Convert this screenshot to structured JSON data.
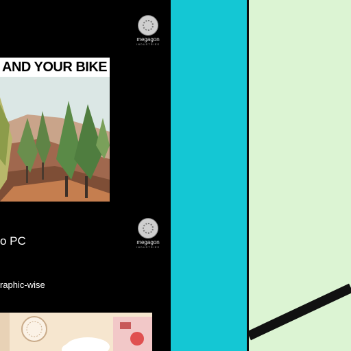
{
  "feed": {
    "card1": {
      "logo": {
        "brand": "megagon",
        "sub": "INDUSTRIES",
        "icon": "megagon-logo-icon"
      },
      "thumbnail_headline": "AND YOUR BIKE"
    },
    "card2": {
      "logo": {
        "brand": "megagon",
        "sub": "INDUSTRIES",
        "icon": "megagon-logo-icon"
      },
      "title": "o PC",
      "snippet": "raphic-wise"
    }
  },
  "colors": {
    "left_bg": "#000000",
    "cyan_panel": "#14c7d4",
    "green_panel": "#dcf4d3",
    "divider": "#0d0d0d"
  }
}
